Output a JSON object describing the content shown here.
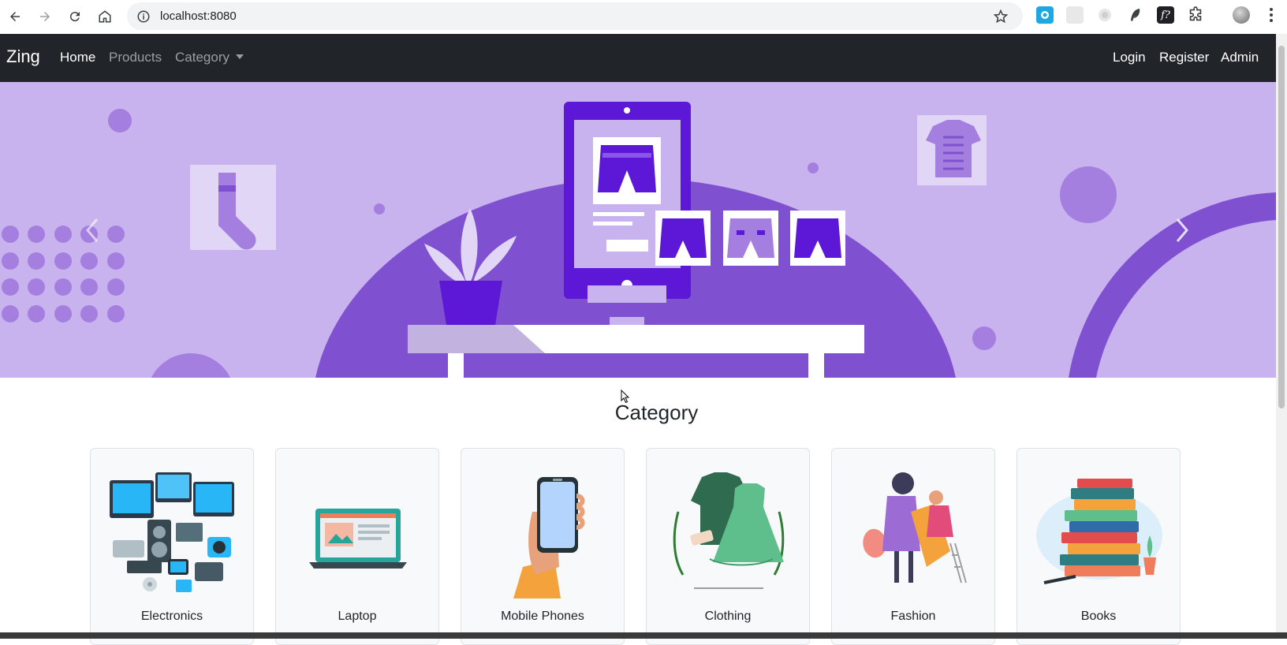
{
  "browser": {
    "url": "localhost:8080",
    "nav_icons": [
      "back-icon",
      "forward-icon",
      "reload-icon",
      "home-icon"
    ],
    "extensions": [
      "screen-recorder-extension-icon",
      "extension-icon",
      "extension-icon",
      "feather-extension-icon",
      "font-extension-icon",
      "puzzle-extensions-icon",
      "profile-avatar-icon",
      "more-menu-icon"
    ]
  },
  "navbar": {
    "brand": "Zing",
    "links": [
      {
        "label": "Home",
        "active": true
      },
      {
        "label": "Products",
        "active": false
      },
      {
        "label": "Category",
        "active": false,
        "dropdown": true
      }
    ],
    "right_links": [
      "Login",
      "Register",
      "Admin"
    ]
  },
  "carousel": {
    "background_color": "#c9b3ee",
    "accent_color": "#7f50cf",
    "dark_color": "#5d17d6"
  },
  "category_section": {
    "title": "Category",
    "cards": [
      {
        "label": "Electronics",
        "icon": "electronics-illustration"
      },
      {
        "label": "Laptop",
        "icon": "laptop-illustration"
      },
      {
        "label": "Mobile Phones",
        "icon": "mobile-phone-illustration"
      },
      {
        "label": "Clothing",
        "icon": "clothing-illustration"
      },
      {
        "label": "Fashion",
        "icon": "fashion-illustration"
      },
      {
        "label": "Books",
        "icon": "books-illustration"
      }
    ]
  }
}
